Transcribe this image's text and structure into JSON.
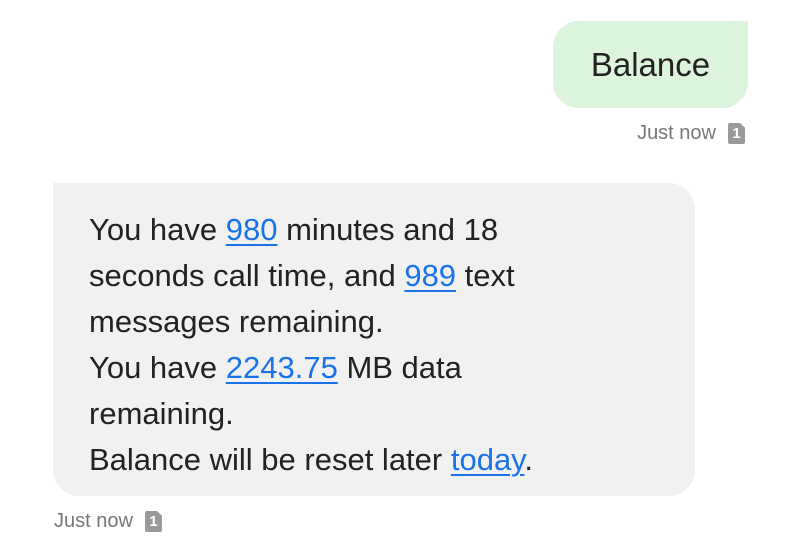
{
  "outgoing": {
    "text": "Balance",
    "time": "Just now",
    "sim": "1"
  },
  "incoming": {
    "line1_a": "You have ",
    "minutes": "980",
    "line1_b": " minutes and 18",
    "line2_a": "seconds call time, and ",
    "texts": "989",
    "line2_b": " text",
    "line3": "messages remaining.",
    "line4_a": "You have ",
    "data_mb": "2243.75",
    "line4_b": " MB data",
    "line5": "remaining.",
    "line6_a": "Balance will be reset later ",
    "reset_when": "today",
    "line6_b": ".",
    "time": "Just now",
    "sim": "1"
  },
  "colors": {
    "outgoing_bubble": "#dcf3dc",
    "incoming_bubble": "#f1f1f1",
    "link": "#1a73e8"
  }
}
